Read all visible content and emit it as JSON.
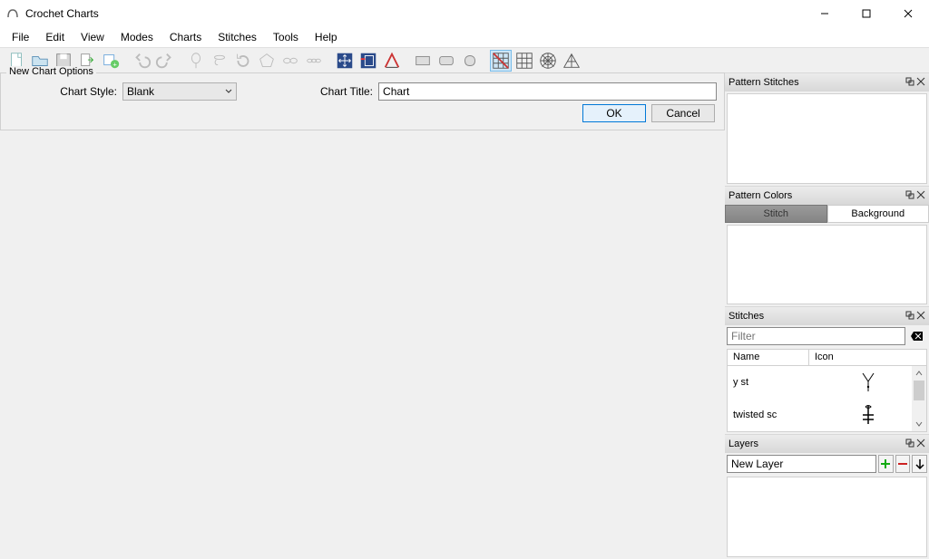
{
  "app": {
    "title": "Crochet Charts"
  },
  "menu": {
    "items": [
      "File",
      "Edit",
      "View",
      "Modes",
      "Charts",
      "Stitches",
      "Tools",
      "Help"
    ]
  },
  "new_chart": {
    "legend": "New Chart Options",
    "style_label": "Chart Style:",
    "style_value": "Blank",
    "title_label": "Chart Title:",
    "title_value": "Chart",
    "ok": "OK",
    "cancel": "Cancel"
  },
  "panels": {
    "pattern_stitches": {
      "title": "Pattern Stitches"
    },
    "pattern_colors": {
      "title": "Pattern Colors",
      "tab_stitch": "Stitch",
      "tab_background": "Background"
    },
    "stitches": {
      "title": "Stitches",
      "filter_placeholder": "Filter",
      "col_name": "Name",
      "col_icon": "Icon",
      "rows": [
        {
          "name": "y st"
        },
        {
          "name": "twisted sc"
        }
      ]
    },
    "layers": {
      "title": "Layers",
      "input": "New Layer"
    }
  }
}
